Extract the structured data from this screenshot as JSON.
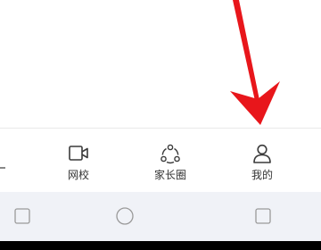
{
  "tabbar": {
    "tabs": [
      {
        "label": "网校",
        "icon": "video-camera-icon"
      },
      {
        "label": "家长圈",
        "icon": "share-circle-icon"
      },
      {
        "label": "我的",
        "icon": "person-icon"
      }
    ]
  },
  "navbar": {
    "buttons": [
      "square-nav-icon",
      "circle-home-icon",
      "square-recents-icon"
    ]
  },
  "annotation": {
    "arrow_color": "#e8161b"
  }
}
